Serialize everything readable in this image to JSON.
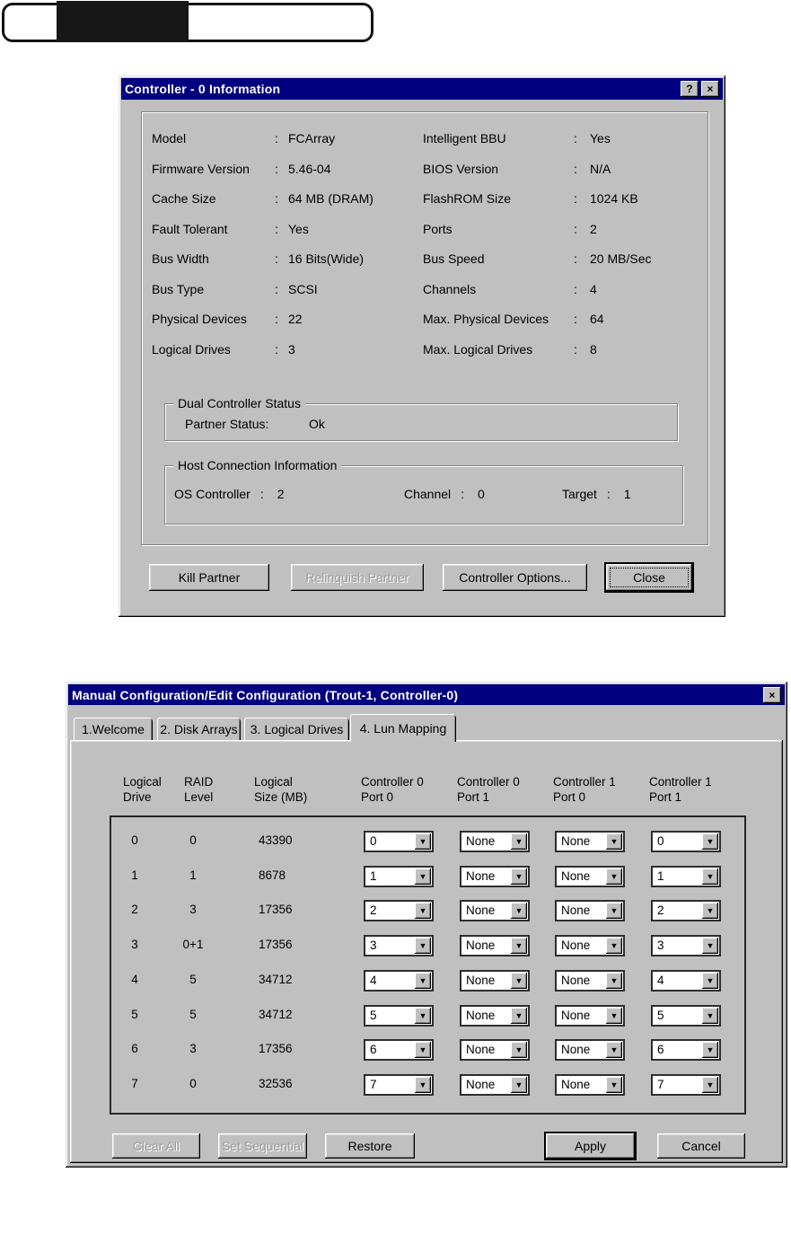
{
  "colors": {
    "titlebar": "#000080",
    "face": "#c0c0c0",
    "logo_block": "#171717"
  },
  "icons": {
    "dropdown_arrow": "▼"
  },
  "dialog1": {
    "title": "Controller - 0 Information",
    "help_glyph": "?",
    "close_glyph": "×",
    "colon": ":",
    "info_left": [
      {
        "label": "Model",
        "value": "FCArray"
      },
      {
        "label": "Firmware Version",
        "value": "5.46-04"
      },
      {
        "label": "Cache Size",
        "value": "64 MB (DRAM)"
      },
      {
        "label": "Fault Tolerant",
        "value": "Yes"
      },
      {
        "label": "Bus Width",
        "value": "16 Bits(Wide)"
      },
      {
        "label": "Bus Type",
        "value": "SCSI"
      },
      {
        "label": "Physical Devices",
        "value": "22"
      },
      {
        "label": "Logical Drives",
        "value": "3"
      }
    ],
    "info_right": [
      {
        "label": "Intelligent BBU",
        "value": "Yes"
      },
      {
        "label": "BIOS Version",
        "value": "N/A"
      },
      {
        "label": "FlashROM Size",
        "value": "1024 KB"
      },
      {
        "label": "Ports",
        "value": "2"
      },
      {
        "label": "Bus Speed",
        "value": "20 MB/Sec"
      },
      {
        "label": "Channels",
        "value": "4"
      },
      {
        "label": "Max. Physical Devices",
        "value": "64"
      },
      {
        "label": "Max. Logical Drives",
        "value": "8"
      }
    ],
    "dual_group": {
      "title": "Dual Controller Status",
      "partner_label": "Partner Status:",
      "partner_value": "Ok"
    },
    "host_group": {
      "title": "Host Connection Information",
      "fields": [
        {
          "label": "OS Controller",
          "value": "2"
        },
        {
          "label": "Channel",
          "value": "0"
        },
        {
          "label": "Target",
          "value": "1"
        }
      ]
    },
    "buttons": [
      {
        "label": "Kill Partner",
        "disabled": false,
        "default": false,
        "focused": false
      },
      {
        "label": "Relinquish Partner",
        "disabled": true,
        "default": false,
        "focused": false
      },
      {
        "label": "Controller Options...",
        "disabled": false,
        "default": false,
        "focused": false
      },
      {
        "label": "Close",
        "disabled": false,
        "default": true,
        "focused": true
      }
    ]
  },
  "dialog2": {
    "title": "Manual Configuration/Edit Configuration (Trout-1, Controller-0)",
    "close_glyph": "×",
    "tabs": [
      {
        "label": "1.Welcome",
        "active": false
      },
      {
        "label": "2. Disk Arrays",
        "active": false
      },
      {
        "label": "3. Logical Drives",
        "active": false
      },
      {
        "label": "4. Lun Mapping",
        "active": true
      }
    ],
    "columns": [
      {
        "line1": "Logical",
        "line2": "Drive"
      },
      {
        "line1": "RAID",
        "line2": "Level"
      },
      {
        "line1": "Logical",
        "line2": "Size (MB)"
      },
      {
        "line1": "Controller 0",
        "line2": "Port 0"
      },
      {
        "line1": "Controller 0",
        "line2": "Port 1"
      },
      {
        "line1": "Controller 1",
        "line2": "Port 0"
      },
      {
        "line1": "Controller 1",
        "line2": "Port 1"
      }
    ],
    "rows": [
      {
        "drive": "0",
        "raid": "0",
        "size": "43390",
        "luns": [
          "0",
          "None",
          "None",
          "0"
        ]
      },
      {
        "drive": "1",
        "raid": "1",
        "size": "8678",
        "luns": [
          "1",
          "None",
          "None",
          "1"
        ]
      },
      {
        "drive": "2",
        "raid": "3",
        "size": "17356",
        "luns": [
          "2",
          "None",
          "None",
          "2"
        ]
      },
      {
        "drive": "3",
        "raid": "0+1",
        "size": "17356",
        "luns": [
          "3",
          "None",
          "None",
          "3"
        ]
      },
      {
        "drive": "4",
        "raid": "5",
        "size": "34712",
        "luns": [
          "4",
          "None",
          "None",
          "4"
        ]
      },
      {
        "drive": "5",
        "raid": "5",
        "size": "34712",
        "luns": [
          "5",
          "None",
          "None",
          "5"
        ]
      },
      {
        "drive": "6",
        "raid": "3",
        "size": "17356",
        "luns": [
          "6",
          "None",
          "None",
          "6"
        ]
      },
      {
        "drive": "7",
        "raid": "0",
        "size": "32536",
        "luns": [
          "7",
          "None",
          "None",
          "7"
        ]
      }
    ],
    "buttons": [
      {
        "label": "Clear All",
        "disabled": true,
        "default": false
      },
      {
        "label": "Set Sequential",
        "disabled": true,
        "default": false
      },
      {
        "label": "Restore",
        "disabled": false,
        "default": false
      },
      {
        "label": "Apply",
        "disabled": false,
        "default": true
      },
      {
        "label": "Cancel",
        "disabled": false,
        "default": false
      }
    ]
  }
}
